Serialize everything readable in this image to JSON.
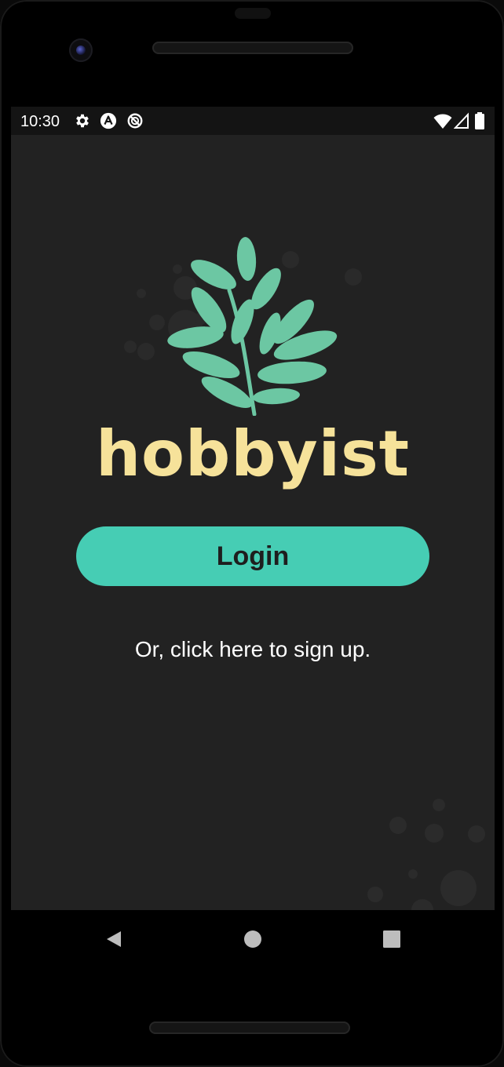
{
  "status_bar": {
    "time": "10:30",
    "left_icons": [
      "gear-icon",
      "notification-a-icon",
      "data-saver-icon"
    ],
    "right_icons": [
      "wifi-icon",
      "signal-icon",
      "battery-icon"
    ]
  },
  "app": {
    "name": "hobbyist",
    "logo": "leaf-branch-logo",
    "login_label": "Login",
    "signup_text": "Or, click here to sign up."
  },
  "nav_bar": {
    "back": "back-triangle-icon",
    "home": "home-circle-icon",
    "recents": "recents-square-icon"
  },
  "colors": {
    "background": "#222222",
    "accent": "#46cdb4",
    "wordmark": "#f6e29a",
    "leaf": "#6cc7a3"
  }
}
